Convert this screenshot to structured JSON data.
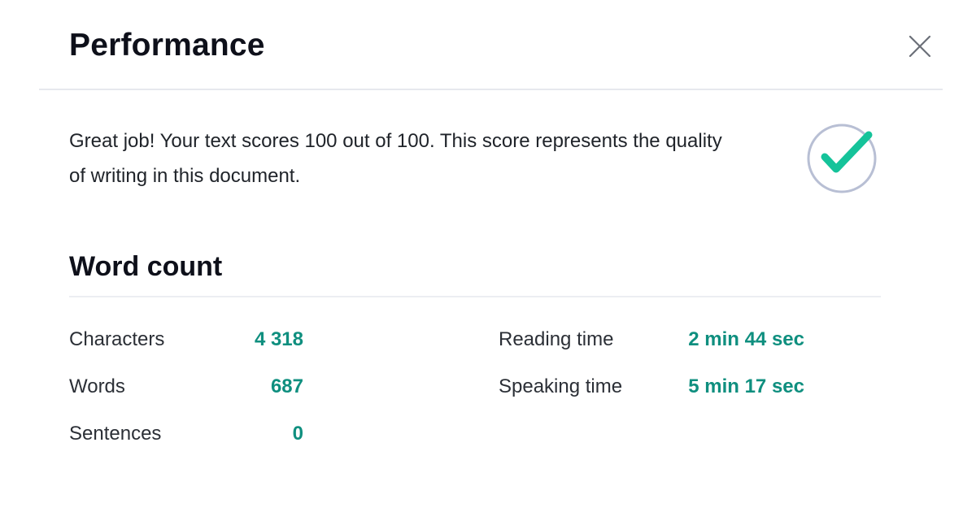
{
  "dialog": {
    "title": "Performance",
    "close_label": "close"
  },
  "score": {
    "message": "Great job! Your text scores 100 out of 100. This score represents the quality of writing in this document.",
    "icon": "check-circle-icon",
    "accent_color": "#15c39a",
    "ring_color": "#b8bfd4"
  },
  "word_count": {
    "title": "Word count",
    "left_stats": [
      {
        "label": "Characters",
        "value": "4 318"
      },
      {
        "label": "Words",
        "value": "687"
      },
      {
        "label": "Sentences",
        "value": "0"
      }
    ],
    "right_stats": [
      {
        "label": "Reading time",
        "value": "2 min 44 sec"
      },
      {
        "label": "Speaking time",
        "value": "5 min 17 sec"
      }
    ],
    "value_color": "#0f8f7f"
  }
}
